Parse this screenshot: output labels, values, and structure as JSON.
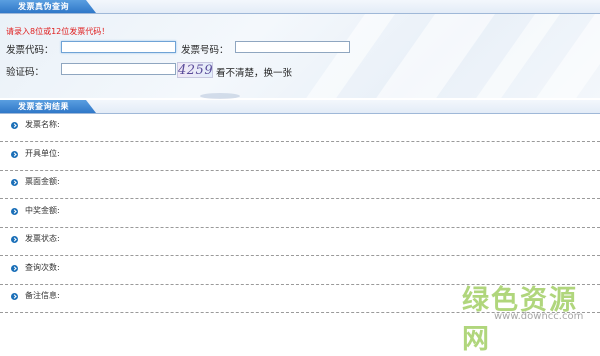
{
  "sections": {
    "verify_title": "发票真伪查询",
    "result_title": "发票查询结果"
  },
  "form": {
    "hint": "请录入8位或12位发票代码！",
    "invoice_code_label": "发票代码：",
    "invoice_code_value": "",
    "invoice_number_label": "发票号码：",
    "invoice_number_value": "",
    "captcha_label": "验证码：",
    "captcha_value": "",
    "captcha_image_text": "4259",
    "refresh_text": "看不清楚，换一张"
  },
  "results": [
    {
      "label": "发票名称:"
    },
    {
      "label": "开具单位:"
    },
    {
      "label": "票面金额:"
    },
    {
      "label": "中奖金额:"
    },
    {
      "label": "发票状态:"
    },
    {
      "label": "查询次数:"
    },
    {
      "label": "备注信息:"
    }
  ],
  "watermark": {
    "text": "绿色资源网",
    "url": "www.downcc.com"
  },
  "colors": {
    "tab_blue": "#2f77c8",
    "hint_red": "#e02020",
    "bullet_blue": "#1a6fb8",
    "watermark_green": "#96c850"
  }
}
